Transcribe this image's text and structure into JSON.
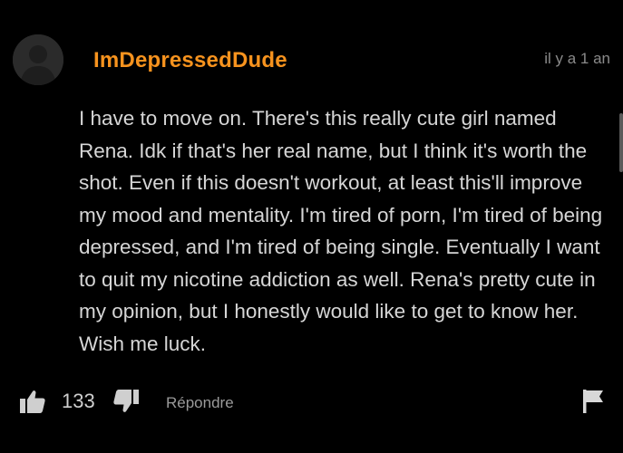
{
  "comment": {
    "author": "ImDepressedDude",
    "timestamp": "il y a 1 an",
    "text": "I have to move on. There's this really cute girl named Rena. Idk if that's her real name, but I think it's worth the shot. Even if this doesn't workout, at least this'll improve my mood and mentality. I'm tired of porn, I'm tired of being depressed, and I'm tired of being single. Eventually I want to quit my nicotine addiction as well. Rena's pretty cute in my opinion, but I honestly would like to get to know her. Wish me luck.",
    "likes": "133",
    "reply_label": "Répondre"
  },
  "icons": {
    "avatar": "default-user-avatar",
    "like": "thumbs-up-icon",
    "dislike": "thumbs-down-icon",
    "flag": "flag-icon"
  },
  "colors": {
    "background": "#000000",
    "author": "#f7931e",
    "text": "#d6d6d6",
    "muted": "#8a8a8a"
  }
}
